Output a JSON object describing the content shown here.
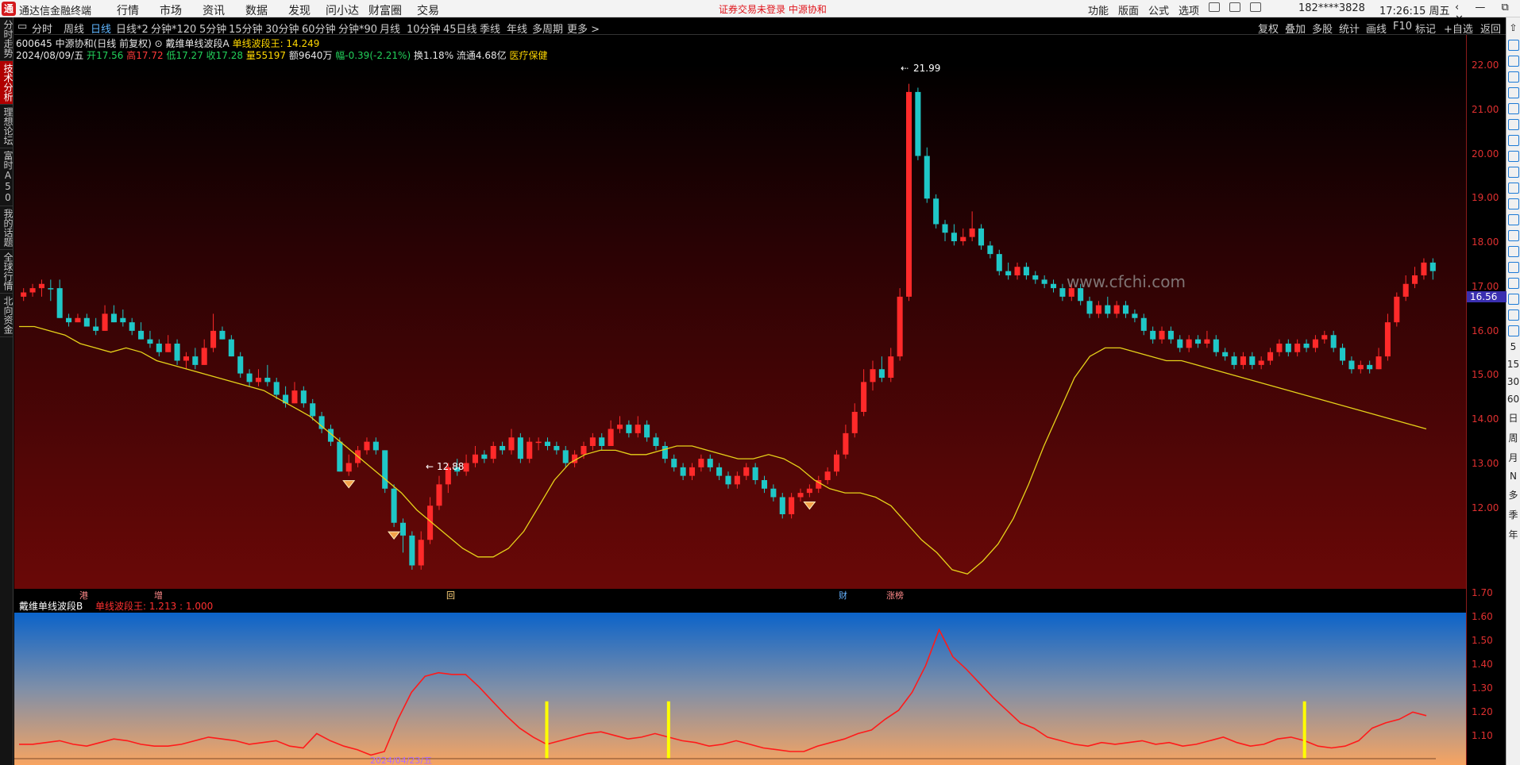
{
  "titlebar": {
    "logo_text": "通",
    "app_name": "通达信金融终端",
    "menu": [
      "行情",
      "市场",
      "资讯",
      "数据",
      "发现",
      "问小达",
      "财富圈",
      "交易"
    ],
    "warning": "证券交易未登录  中源协和",
    "right_items": [
      "功能",
      "版面",
      "公式",
      "选项"
    ],
    "account": "182****3828",
    "clock": "17:26:15 周五",
    "window_buttons": "‹ — ⧉ ✕"
  },
  "left_tabs": [
    "分时走势",
    "技术分析",
    "理想论坛",
    "富时A50",
    "我的话题",
    "全球行情",
    "北向资金"
  ],
  "left_tab_active": 1,
  "period_bar": {
    "periods": [
      "分时",
      "周线",
      "日线",
      "日线*2",
      "分钟*120",
      "5分钟",
      "15分钟",
      "30分钟",
      "60分钟",
      "分钟*90",
      "月线",
      "10分钟",
      "45日线",
      "季线",
      "年线",
      "多周期",
      "更多 >"
    ],
    "active": "日线",
    "tools": [
      "复权",
      "叠加",
      "多股",
      "统计",
      "画线",
      "F10",
      "标记",
      "+自选",
      "返回"
    ]
  },
  "info_line1": {
    "code_name": "600645 中源协和(日线 前复权)",
    "indicator": "戴维单线波段A",
    "indicator_value": "单线波段王: 14.249"
  },
  "info_line2": {
    "date": "2024/08/09/五",
    "open_label": "开",
    "open": "17.56",
    "high_label": "高",
    "high": "17.72",
    "low_label": "低",
    "low": "17.27",
    "close_label": "收",
    "close": "17.28",
    "volume_label": "量",
    "volume": "55197",
    "amount": "额9640万",
    "change": "幅-0.39(-2.21%)",
    "turnover": "换1.18%",
    "float_cap": "流通4.68亿",
    "sector": "医疗保健"
  },
  "price_axis": [
    "22.00",
    "21.00",
    "20.00",
    "19.00",
    "18.00",
    "17.00",
    "16.00",
    "15.00",
    "14.00",
    "13.00",
    "12.00"
  ],
  "current_price_tag": "16.56",
  "high_mark": "21.99",
  "low_mark": "12.88",
  "watermark": "www.cfchi.com",
  "event_markers": [
    "港",
    "增",
    "回",
    "财",
    "涨榜"
  ],
  "sub_panel": {
    "title": "戴维单线波段B",
    "value_label": "单线波段王: 1.213 : 1.000",
    "axis": [
      "1.70",
      "1.60",
      "1.50",
      "1.40",
      "1.30",
      "1.20",
      "1.10"
    ],
    "date_hint": "2024/04/23/五"
  },
  "right_bar_labels": [
    "日",
    "周",
    "月",
    "N",
    "多",
    "季",
    "年"
  ],
  "right_bar_nums": [
    "5",
    "15",
    "30",
    "60"
  ],
  "colors": {
    "up": "#ff2a2a",
    "down": "#1fc7c7",
    "ma_line": "#e6d21a",
    "sub_line": "#ff1a1a",
    "signal": "#ffff00",
    "active_tab": "#b00000"
  },
  "chart_data": {
    "type": "candlestick",
    "price_range": [
      11.5,
      22.0
    ],
    "candles": [
      [
        17.0,
        17.1,
        16.9,
        17.2,
        1
      ],
      [
        17.1,
        17.2,
        17.0,
        17.3,
        1
      ],
      [
        17.2,
        17.3,
        17.0,
        17.4,
        1
      ],
      [
        17.2,
        17.2,
        16.9,
        17.4,
        -1
      ],
      [
        17.2,
        16.5,
        16.5,
        17.4,
        -1
      ],
      [
        16.5,
        16.4,
        16.3,
        16.6,
        -1
      ],
      [
        16.4,
        16.5,
        16.4,
        16.6,
        1
      ],
      [
        16.5,
        16.3,
        16.3,
        16.6,
        -1
      ],
      [
        16.3,
        16.2,
        16.1,
        16.5,
        -1
      ],
      [
        16.2,
        16.6,
        16.2,
        16.8,
        1
      ],
      [
        16.6,
        16.4,
        16.4,
        16.8,
        -1
      ],
      [
        16.5,
        16.4,
        16.3,
        16.7,
        -1
      ],
      [
        16.4,
        16.2,
        16.1,
        16.5,
        -1
      ],
      [
        16.2,
        16.0,
        16.0,
        16.4,
        -1
      ],
      [
        16.0,
        15.9,
        15.8,
        16.2,
        -1
      ],
      [
        15.9,
        15.7,
        15.6,
        16.0,
        -1
      ],
      [
        15.7,
        15.9,
        15.7,
        16.1,
        1
      ],
      [
        15.9,
        15.5,
        15.4,
        16.0,
        -1
      ],
      [
        15.5,
        15.6,
        15.3,
        15.7,
        1
      ],
      [
        15.6,
        15.4,
        15.3,
        15.8,
        -1
      ],
      [
        15.4,
        15.8,
        15.4,
        16.0,
        1
      ],
      [
        15.8,
        16.2,
        15.7,
        16.6,
        1
      ],
      [
        16.2,
        16.0,
        16.0,
        16.3,
        -1
      ],
      [
        16.0,
        15.6,
        15.6,
        16.1,
        -1
      ],
      [
        15.6,
        15.2,
        15.1,
        15.7,
        -1
      ],
      [
        15.2,
        15.0,
        14.9,
        15.3,
        -1
      ],
      [
        15.0,
        15.1,
        14.9,
        15.3,
        1
      ],
      [
        15.1,
        15.0,
        14.9,
        15.4,
        -1
      ],
      [
        15.0,
        14.7,
        14.6,
        15.1,
        -1
      ],
      [
        14.7,
        14.5,
        14.4,
        14.9,
        -1
      ],
      [
        14.5,
        14.8,
        14.5,
        15.0,
        1
      ],
      [
        14.8,
        14.5,
        14.4,
        14.9,
        -1
      ],
      [
        14.5,
        14.2,
        14.1,
        14.6,
        -1
      ],
      [
        14.2,
        13.9,
        13.8,
        14.3,
        -1
      ],
      [
        13.9,
        13.6,
        13.5,
        14.0,
        -1
      ],
      [
        13.6,
        12.9,
        12.9,
        13.7,
        -1
      ],
      [
        12.9,
        13.1,
        12.8,
        13.3,
        1
      ],
      [
        13.1,
        13.4,
        13.0,
        13.5,
        1
      ],
      [
        13.4,
        13.6,
        13.3,
        13.7,
        1
      ],
      [
        13.6,
        13.4,
        13.3,
        13.7,
        -1
      ],
      [
        13.4,
        12.5,
        12.4,
        13.4,
        -1
      ],
      [
        12.5,
        11.7,
        11.6,
        12.6,
        -1
      ],
      [
        11.7,
        11.4,
        11.0,
        11.8,
        -1
      ],
      [
        11.4,
        10.7,
        10.6,
        11.5,
        -1
      ],
      [
        10.7,
        11.3,
        10.6,
        11.5,
        1
      ],
      [
        11.3,
        12.1,
        11.2,
        12.3,
        1
      ],
      [
        12.1,
        12.6,
        12.0,
        12.8,
        1
      ],
      [
        12.6,
        13.0,
        12.4,
        13.1,
        1
      ],
      [
        13.0,
        12.9,
        12.8,
        13.2,
        -1
      ],
      [
        12.9,
        13.1,
        12.8,
        13.3,
        1
      ],
      [
        13.1,
        13.3,
        13.0,
        13.5,
        1
      ],
      [
        13.3,
        13.2,
        13.1,
        13.4,
        -1
      ],
      [
        13.2,
        13.5,
        13.1,
        13.6,
        1
      ],
      [
        13.5,
        13.4,
        13.3,
        13.6,
        -1
      ],
      [
        13.4,
        13.7,
        13.3,
        13.9,
        1
      ],
      [
        13.7,
        13.2,
        13.1,
        13.8,
        -1
      ],
      [
        13.2,
        13.6,
        13.1,
        13.7,
        1
      ],
      [
        13.6,
        13.6,
        13.4,
        13.7,
        1
      ],
      [
        13.6,
        13.5,
        13.4,
        13.7,
        -1
      ],
      [
        13.5,
        13.4,
        13.3,
        13.6,
        -1
      ],
      [
        13.4,
        13.1,
        13.0,
        13.5,
        -1
      ],
      [
        13.1,
        13.3,
        13.0,
        13.4,
        1
      ],
      [
        13.3,
        13.5,
        13.2,
        13.6,
        1
      ],
      [
        13.5,
        13.7,
        13.4,
        13.8,
        1
      ],
      [
        13.7,
        13.5,
        13.4,
        13.8,
        -1
      ],
      [
        13.5,
        13.9,
        13.5,
        14.1,
        1
      ],
      [
        13.9,
        14.0,
        13.8,
        14.2,
        1
      ],
      [
        14.0,
        13.8,
        13.7,
        14.1,
        -1
      ],
      [
        13.8,
        14.0,
        13.7,
        14.2,
        1
      ],
      [
        14.0,
        13.7,
        13.6,
        14.1,
        -1
      ],
      [
        13.7,
        13.5,
        13.4,
        13.8,
        -1
      ],
      [
        13.5,
        13.2,
        13.1,
        13.6,
        -1
      ],
      [
        13.2,
        13.0,
        12.9,
        13.3,
        -1
      ],
      [
        13.0,
        12.8,
        12.7,
        13.1,
        -1
      ],
      [
        12.8,
        13.0,
        12.7,
        13.1,
        1
      ],
      [
        13.0,
        13.2,
        12.9,
        13.3,
        1
      ],
      [
        13.2,
        13.0,
        12.9,
        13.3,
        -1
      ],
      [
        13.0,
        12.8,
        12.7,
        13.1,
        -1
      ],
      [
        12.8,
        12.6,
        12.5,
        12.9,
        -1
      ],
      [
        12.6,
        12.8,
        12.5,
        12.9,
        1
      ],
      [
        12.8,
        13.0,
        12.7,
        13.1,
        1
      ],
      [
        13.0,
        12.7,
        12.6,
        13.1,
        -1
      ],
      [
        12.7,
        12.5,
        12.4,
        12.8,
        -1
      ],
      [
        12.5,
        12.3,
        12.2,
        12.6,
        -1
      ],
      [
        12.3,
        11.9,
        11.8,
        12.4,
        -1
      ],
      [
        11.9,
        12.3,
        11.8,
        12.4,
        1
      ],
      [
        12.3,
        12.4,
        12.2,
        12.5,
        1
      ],
      [
        12.4,
        12.5,
        12.3,
        12.6,
        1
      ],
      [
        12.5,
        12.7,
        12.4,
        12.8,
        1
      ],
      [
        12.7,
        12.9,
        12.6,
        13.0,
        1
      ],
      [
        12.9,
        13.3,
        12.8,
        13.4,
        1
      ],
      [
        13.3,
        13.8,
        13.2,
        14.0,
        1
      ],
      [
        13.8,
        14.3,
        13.7,
        14.5,
        1
      ],
      [
        14.3,
        15.0,
        14.2,
        15.3,
        1
      ],
      [
        15.0,
        15.3,
        14.8,
        15.5,
        1
      ],
      [
        15.3,
        15.1,
        15.0,
        15.6,
        -1
      ],
      [
        15.1,
        15.6,
        15.0,
        15.8,
        1
      ],
      [
        15.6,
        17.0,
        15.5,
        17.2,
        1
      ],
      [
        17.0,
        21.8,
        16.9,
        21.99,
        1
      ],
      [
        21.8,
        20.3,
        20.2,
        21.9,
        -1
      ],
      [
        20.3,
        19.3,
        19.2,
        20.5,
        -1
      ],
      [
        19.3,
        18.7,
        18.6,
        19.4,
        -1
      ],
      [
        18.7,
        18.5,
        18.3,
        18.8,
        -1
      ],
      [
        18.5,
        18.3,
        18.2,
        18.7,
        -1
      ],
      [
        18.3,
        18.4,
        18.2,
        18.6,
        1
      ],
      [
        18.4,
        18.6,
        18.3,
        19.0,
        1
      ],
      [
        18.6,
        18.2,
        18.1,
        18.7,
        -1
      ],
      [
        18.2,
        18.0,
        17.9,
        18.3,
        -1
      ],
      [
        18.0,
        17.6,
        17.5,
        18.1,
        -1
      ],
      [
        17.6,
        17.5,
        17.4,
        17.8,
        -1
      ],
      [
        17.5,
        17.7,
        17.4,
        17.8,
        1
      ],
      [
        17.7,
        17.5,
        17.4,
        17.8,
        -1
      ],
      [
        17.5,
        17.4,
        17.3,
        17.6,
        -1
      ],
      [
        17.4,
        17.3,
        17.2,
        17.5,
        -1
      ],
      [
        17.3,
        17.2,
        17.1,
        17.4,
        -1
      ],
      [
        17.2,
        17.0,
        16.9,
        17.3,
        -1
      ],
      [
        17.0,
        17.2,
        16.9,
        17.3,
        1
      ],
      [
        17.2,
        16.9,
        16.8,
        17.3,
        -1
      ],
      [
        16.9,
        16.6,
        16.5,
        17.0,
        -1
      ],
      [
        16.6,
        16.8,
        16.5,
        16.9,
        1
      ],
      [
        16.8,
        16.6,
        16.5,
        17.0,
        -1
      ],
      [
        16.6,
        16.8,
        16.5,
        16.9,
        1
      ],
      [
        16.8,
        16.6,
        16.5,
        16.9,
        -1
      ],
      [
        16.6,
        16.5,
        16.4,
        16.7,
        -1
      ],
      [
        16.5,
        16.2,
        16.1,
        16.6,
        -1
      ],
      [
        16.2,
        16.0,
        15.9,
        16.3,
        -1
      ],
      [
        16.0,
        16.2,
        15.9,
        16.3,
        1
      ],
      [
        16.2,
        16.0,
        15.9,
        16.3,
        -1
      ],
      [
        16.0,
        15.8,
        15.7,
        16.1,
        -1
      ],
      [
        15.8,
        16.0,
        15.7,
        16.1,
        1
      ],
      [
        16.0,
        15.9,
        15.8,
        16.1,
        -1
      ],
      [
        15.9,
        16.0,
        15.8,
        16.2,
        1
      ],
      [
        16.0,
        15.7,
        15.6,
        16.1,
        -1
      ],
      [
        15.7,
        15.6,
        15.5,
        15.8,
        -1
      ],
      [
        15.6,
        15.4,
        15.3,
        15.7,
        -1
      ],
      [
        15.4,
        15.6,
        15.3,
        15.7,
        1
      ],
      [
        15.6,
        15.4,
        15.3,
        15.7,
        -1
      ],
      [
        15.4,
        15.5,
        15.3,
        15.6,
        1
      ],
      [
        15.5,
        15.7,
        15.4,
        15.8,
        1
      ],
      [
        15.7,
        15.9,
        15.6,
        16.0,
        1
      ],
      [
        15.9,
        15.7,
        15.6,
        16.0,
        -1
      ],
      [
        15.7,
        15.9,
        15.6,
        16.0,
        1
      ],
      [
        15.9,
        15.8,
        15.7,
        16.0,
        -1
      ],
      [
        15.8,
        16.0,
        15.7,
        16.1,
        1
      ],
      [
        16.0,
        16.1,
        15.9,
        16.2,
        1
      ],
      [
        16.1,
        15.8,
        15.7,
        16.2,
        -1
      ],
      [
        15.8,
        15.5,
        15.4,
        15.9,
        -1
      ],
      [
        15.5,
        15.3,
        15.2,
        15.6,
        -1
      ],
      [
        15.3,
        15.4,
        15.2,
        15.5,
        1
      ],
      [
        15.4,
        15.3,
        15.2,
        15.5,
        -1
      ],
      [
        15.3,
        15.6,
        15.3,
        15.8,
        1
      ],
      [
        15.6,
        16.4,
        15.5,
        16.6,
        1
      ],
      [
        16.4,
        17.0,
        16.3,
        17.1,
        1
      ],
      [
        17.0,
        17.3,
        16.9,
        17.5,
        1
      ],
      [
        17.3,
        17.5,
        17.2,
        17.7,
        1
      ],
      [
        17.5,
        17.8,
        17.4,
        17.9,
        1
      ],
      [
        17.8,
        17.6,
        17.4,
        17.9,
        -1
      ]
    ],
    "ma_line": [
      16.3,
      16.3,
      16.2,
      16.1,
      15.9,
      15.8,
      15.7,
      15.8,
      15.7,
      15.5,
      15.4,
      15.3,
      15.2,
      15.1,
      15.0,
      14.9,
      14.8,
      14.6,
      14.4,
      14.2,
      13.9,
      13.6,
      13.3,
      13.0,
      12.7,
      12.4,
      12.0,
      11.7,
      11.4,
      11.1,
      10.9,
      10.9,
      11.1,
      11.5,
      12.1,
      12.7,
      13.1,
      13.3,
      13.4,
      13.4,
      13.3,
      13.3,
      13.4,
      13.5,
      13.5,
      13.4,
      13.3,
      13.2,
      13.2,
      13.3,
      13.2,
      13.0,
      12.7,
      12.5,
      12.4,
      12.4,
      12.3,
      12.1,
      11.7,
      11.3,
      11.0,
      10.6,
      10.5,
      10.8,
      11.2,
      11.8,
      12.6,
      13.5,
      14.3,
      15.1,
      15.6,
      15.8,
      15.8,
      15.7,
      15.6,
      15.5,
      15.5,
      15.4,
      15.3,
      15.2,
      15.1,
      15.0,
      14.9,
      14.8,
      14.7,
      14.6,
      14.5,
      14.4,
      14.3,
      14.2,
      14.1,
      14.0,
      13.9
    ],
    "low_markers_x_index": [
      36,
      41,
      87
    ],
    "sub_line": [
      1.06,
      1.06,
      1.07,
      1.08,
      1.06,
      1.05,
      1.07,
      1.09,
      1.08,
      1.06,
      1.05,
      1.05,
      1.06,
      1.08,
      1.1,
      1.09,
      1.08,
      1.06,
      1.07,
      1.08,
      1.05,
      1.04,
      1.12,
      1.08,
      1.05,
      1.03,
      1.0,
      1.02,
      1.2,
      1.35,
      1.44,
      1.46,
      1.45,
      1.45,
      1.38,
      1.3,
      1.22,
      1.15,
      1.1,
      1.06,
      1.08,
      1.1,
      1.12,
      1.13,
      1.11,
      1.09,
      1.1,
      1.12,
      1.1,
      1.08,
      1.07,
      1.05,
      1.06,
      1.08,
      1.06,
      1.04,
      1.03,
      1.02,
      1.02,
      1.05,
      1.07,
      1.09,
      1.12,
      1.14,
      1.2,
      1.25,
      1.35,
      1.5,
      1.7,
      1.55,
      1.48,
      1.4,
      1.32,
      1.25,
      1.18,
      1.15,
      1.1,
      1.08,
      1.06,
      1.05,
      1.07,
      1.06,
      1.07,
      1.08,
      1.06,
      1.07,
      1.05,
      1.06,
      1.08,
      1.1,
      1.07,
      1.05,
      1.06,
      1.09,
      1.1,
      1.08,
      1.05,
      1.04,
      1.05,
      1.08,
      1.15,
      1.18,
      1.2,
      1.24,
      1.22
    ],
    "sub_signals_index": [
      39,
      48,
      95
    ]
  }
}
